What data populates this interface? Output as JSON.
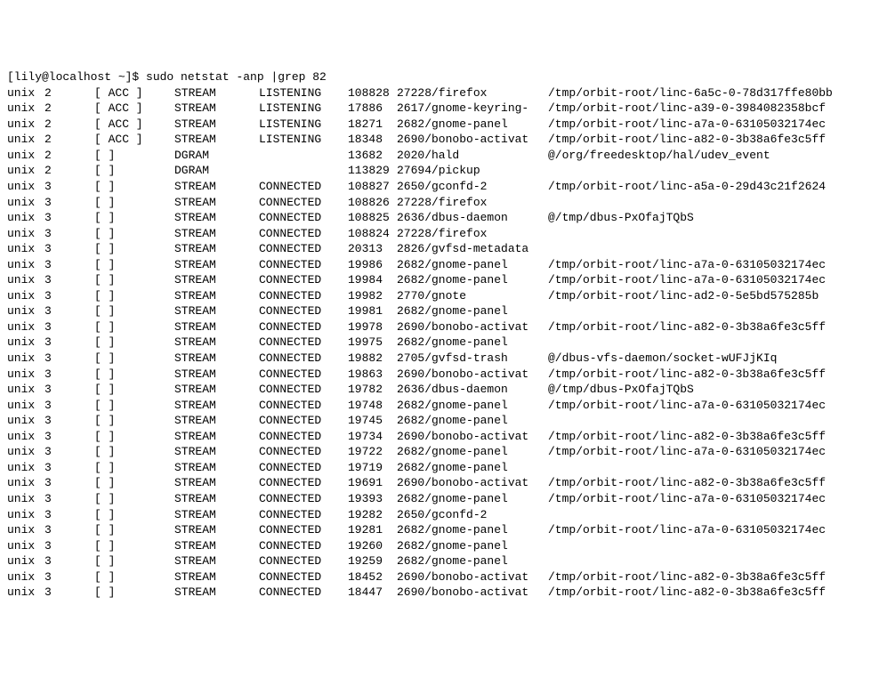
{
  "prompt": "[lily@localhost ~]$ sudo netstat -anp |grep 82",
  "rows": [
    {
      "proto": "unix",
      "refcnt": "2",
      "flags": "[ ACC ]",
      "type": "STREAM",
      "state": "LISTENING",
      "inode": "108828",
      "prog": "27228/firefox",
      "path": "/tmp/orbit-root/linc-6a5c-0-78d317ffe80bb"
    },
    {
      "proto": "unix",
      "refcnt": "2",
      "flags": "[ ACC ]",
      "type": "STREAM",
      "state": "LISTENING",
      "inode": "17886",
      "prog": "2617/gnome-keyring-",
      "path": "/tmp/orbit-root/linc-a39-0-3984082358bcf"
    },
    {
      "proto": "unix",
      "refcnt": "2",
      "flags": "[ ACC ]",
      "type": "STREAM",
      "state": "LISTENING",
      "inode": "18271",
      "prog": "2682/gnome-panel",
      "path": "/tmp/orbit-root/linc-a7a-0-63105032174ec"
    },
    {
      "proto": "unix",
      "refcnt": "2",
      "flags": "[ ACC ]",
      "type": "STREAM",
      "state": "LISTENING",
      "inode": "18348",
      "prog": "2690/bonobo-activat",
      "path": "/tmp/orbit-root/linc-a82-0-3b38a6fe3c5ff"
    },
    {
      "proto": "unix",
      "refcnt": "2",
      "flags": "[ ]",
      "type": "DGRAM",
      "state": "",
      "inode": "13682",
      "prog": "2020/hald",
      "path": "@/org/freedesktop/hal/udev_event"
    },
    {
      "proto": "unix",
      "refcnt": "2",
      "flags": "[ ]",
      "type": "DGRAM",
      "state": "",
      "inode": "113829",
      "prog": "27694/pickup",
      "path": ""
    },
    {
      "proto": "unix",
      "refcnt": "3",
      "flags": "[ ]",
      "type": "STREAM",
      "state": "CONNECTED",
      "inode": "108827",
      "prog": "2650/gconfd-2",
      "path": "/tmp/orbit-root/linc-a5a-0-29d43c21f2624"
    },
    {
      "proto": "unix",
      "refcnt": "3",
      "flags": "[ ]",
      "type": "STREAM",
      "state": "CONNECTED",
      "inode": "108826",
      "prog": "27228/firefox",
      "path": ""
    },
    {
      "proto": "unix",
      "refcnt": "3",
      "flags": "[ ]",
      "type": "STREAM",
      "state": "CONNECTED",
      "inode": "108825",
      "prog": "2636/dbus-daemon",
      "path": "@/tmp/dbus-PxOfajTQbS"
    },
    {
      "proto": "unix",
      "refcnt": "3",
      "flags": "[ ]",
      "type": "STREAM",
      "state": "CONNECTED",
      "inode": "108824",
      "prog": "27228/firefox",
      "path": ""
    },
    {
      "proto": "unix",
      "refcnt": "3",
      "flags": "[ ]",
      "type": "STREAM",
      "state": "CONNECTED",
      "inode": "20313",
      "prog": "2826/gvfsd-metadata",
      "path": ""
    },
    {
      "proto": "unix",
      "refcnt": "3",
      "flags": "[ ]",
      "type": "STREAM",
      "state": "CONNECTED",
      "inode": "19986",
      "prog": "2682/gnome-panel",
      "path": "/tmp/orbit-root/linc-a7a-0-63105032174ec"
    },
    {
      "proto": "unix",
      "refcnt": "3",
      "flags": "[ ]",
      "type": "STREAM",
      "state": "CONNECTED",
      "inode": "19984",
      "prog": "2682/gnome-panel",
      "path": "/tmp/orbit-root/linc-a7a-0-63105032174ec"
    },
    {
      "proto": "unix",
      "refcnt": "3",
      "flags": "[ ]",
      "type": "STREAM",
      "state": "CONNECTED",
      "inode": "19982",
      "prog": "2770/gnote",
      "path": "/tmp/orbit-root/linc-ad2-0-5e5bd575285b"
    },
    {
      "proto": "unix",
      "refcnt": "3",
      "flags": "[ ]",
      "type": "STREAM",
      "state": "CONNECTED",
      "inode": "19981",
      "prog": "2682/gnome-panel",
      "path": ""
    },
    {
      "proto": "unix",
      "refcnt": "3",
      "flags": "[ ]",
      "type": "STREAM",
      "state": "CONNECTED",
      "inode": "19978",
      "prog": "2690/bonobo-activat",
      "path": "/tmp/orbit-root/linc-a82-0-3b38a6fe3c5ff"
    },
    {
      "proto": "unix",
      "refcnt": "3",
      "flags": "[ ]",
      "type": "STREAM",
      "state": "CONNECTED",
      "inode": "19975",
      "prog": "2682/gnome-panel",
      "path": ""
    },
    {
      "proto": "unix",
      "refcnt": "3",
      "flags": "[ ]",
      "type": "STREAM",
      "state": "CONNECTED",
      "inode": "19882",
      "prog": "2705/gvfsd-trash",
      "path": "@/dbus-vfs-daemon/socket-wUFJjKIq"
    },
    {
      "proto": "unix",
      "refcnt": "3",
      "flags": "[ ]",
      "type": "STREAM",
      "state": "CONNECTED",
      "inode": "19863",
      "prog": "2690/bonobo-activat",
      "path": "/tmp/orbit-root/linc-a82-0-3b38a6fe3c5ff"
    },
    {
      "proto": "unix",
      "refcnt": "3",
      "flags": "[ ]",
      "type": "STREAM",
      "state": "CONNECTED",
      "inode": "19782",
      "prog": "2636/dbus-daemon",
      "path": "@/tmp/dbus-PxOfajTQbS"
    },
    {
      "proto": "unix",
      "refcnt": "3",
      "flags": "[ ]",
      "type": "STREAM",
      "state": "CONNECTED",
      "inode": "19748",
      "prog": "2682/gnome-panel",
      "path": "/tmp/orbit-root/linc-a7a-0-63105032174ec"
    },
    {
      "proto": "unix",
      "refcnt": "3",
      "flags": "[ ]",
      "type": "STREAM",
      "state": "CONNECTED",
      "inode": "19745",
      "prog": "2682/gnome-panel",
      "path": ""
    },
    {
      "proto": "unix",
      "refcnt": "3",
      "flags": "[ ]",
      "type": "STREAM",
      "state": "CONNECTED",
      "inode": "19734",
      "prog": "2690/bonobo-activat",
      "path": "/tmp/orbit-root/linc-a82-0-3b38a6fe3c5ff"
    },
    {
      "proto": "unix",
      "refcnt": "3",
      "flags": "[ ]",
      "type": "STREAM",
      "state": "CONNECTED",
      "inode": "19722",
      "prog": "2682/gnome-panel",
      "path": "/tmp/orbit-root/linc-a7a-0-63105032174ec"
    },
    {
      "proto": "unix",
      "refcnt": "3",
      "flags": "[ ]",
      "type": "STREAM",
      "state": "CONNECTED",
      "inode": "19719",
      "prog": "2682/gnome-panel",
      "path": ""
    },
    {
      "proto": "unix",
      "refcnt": "3",
      "flags": "[ ]",
      "type": "STREAM",
      "state": "CONNECTED",
      "inode": "19691",
      "prog": "2690/bonobo-activat",
      "path": "/tmp/orbit-root/linc-a82-0-3b38a6fe3c5ff"
    },
    {
      "proto": "unix",
      "refcnt": "3",
      "flags": "[ ]",
      "type": "STREAM",
      "state": "CONNECTED",
      "inode": "19393",
      "prog": "2682/gnome-panel",
      "path": "/tmp/orbit-root/linc-a7a-0-63105032174ec"
    },
    {
      "proto": "unix",
      "refcnt": "3",
      "flags": "[ ]",
      "type": "STREAM",
      "state": "CONNECTED",
      "inode": "19282",
      "prog": "2650/gconfd-2",
      "path": ""
    },
    {
      "proto": "unix",
      "refcnt": "3",
      "flags": "[ ]",
      "type": "STREAM",
      "state": "CONNECTED",
      "inode": "19281",
      "prog": "2682/gnome-panel",
      "path": "/tmp/orbit-root/linc-a7a-0-63105032174ec"
    },
    {
      "proto": "unix",
      "refcnt": "3",
      "flags": "[ ]",
      "type": "STREAM",
      "state": "CONNECTED",
      "inode": "19260",
      "prog": "2682/gnome-panel",
      "path": ""
    },
    {
      "proto": "unix",
      "refcnt": "3",
      "flags": "[ ]",
      "type": "STREAM",
      "state": "CONNECTED",
      "inode": "19259",
      "prog": "2682/gnome-panel",
      "path": ""
    },
    {
      "proto": "unix",
      "refcnt": "3",
      "flags": "[ ]",
      "type": "STREAM",
      "state": "CONNECTED",
      "inode": "18452",
      "prog": "2690/bonobo-activat",
      "path": "/tmp/orbit-root/linc-a82-0-3b38a6fe3c5ff"
    },
    {
      "proto": "unix",
      "refcnt": "3",
      "flags": "[ ]",
      "type": "STREAM",
      "state": "CONNECTED",
      "inode": "18447",
      "prog": "2690/bonobo-activat",
      "path": "/tmp/orbit-root/linc-a82-0-3b38a6fe3c5ff"
    }
  ]
}
